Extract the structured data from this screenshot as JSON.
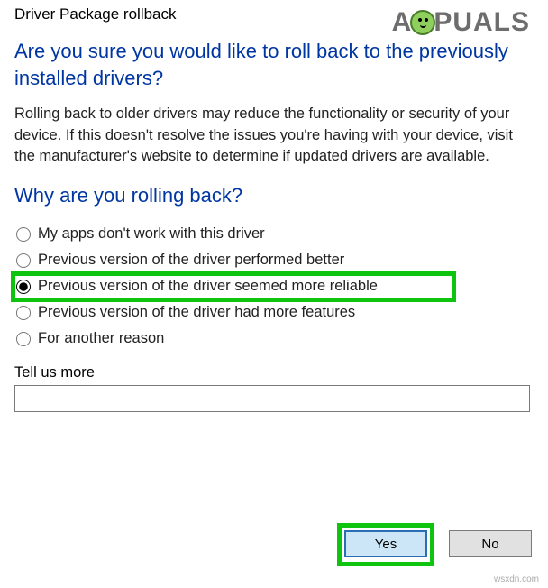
{
  "window": {
    "title": "Driver Package rollback"
  },
  "logo": {
    "pre": "A",
    "post": "PUALS"
  },
  "heading1": "Are you sure you would like to roll back to the previously installed drivers?",
  "body": "Rolling back to older drivers may reduce the functionality or security of your device.  If this doesn't resolve the issues you're having with your device, visit the manufacturer's website to determine if updated drivers are available.",
  "heading2": "Why are you rolling back?",
  "reasons": [
    "My apps don't work with this driver",
    "Previous version of the driver performed better",
    "Previous version of the driver seemed more reliable",
    "Previous version of the driver had more features",
    "For another reason"
  ],
  "selected_index": 2,
  "tellmore": {
    "label": "Tell us more",
    "value": ""
  },
  "buttons": {
    "yes": "Yes",
    "no": "No"
  },
  "watermark": "wsxdn.com"
}
